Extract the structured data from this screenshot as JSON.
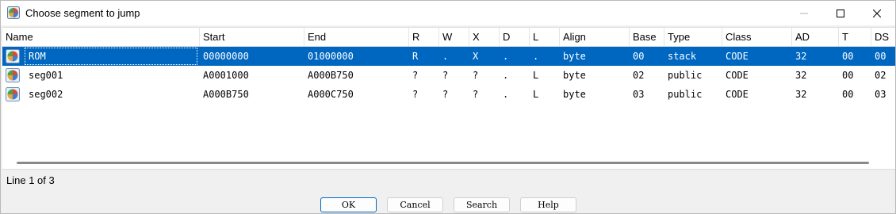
{
  "window": {
    "title": "Choose segment to jump"
  },
  "table": {
    "columns": [
      "Name",
      "Start",
      "End",
      "R",
      "W",
      "X",
      "D",
      "L",
      "Align",
      "Base",
      "Type",
      "Class",
      "AD",
      "T",
      "DS"
    ],
    "rows": [
      [
        "ROM",
        "00000000",
        "01000000",
        "R",
        ".",
        "X",
        ".",
        ".",
        "byte",
        "00",
        "stack",
        "CODE",
        "32",
        "00",
        "00"
      ],
      [
        "seg001",
        "A0001000",
        "A000B750",
        "?",
        "?",
        "?",
        ".",
        "L",
        "byte",
        "02",
        "public",
        "CODE",
        "32",
        "00",
        "02"
      ],
      [
        "seg002",
        "A000B750",
        "A000C750",
        "?",
        "?",
        "?",
        ".",
        "L",
        "byte",
        "03",
        "public",
        "CODE",
        "32",
        "00",
        "03"
      ]
    ],
    "selected_row": 0
  },
  "status": {
    "text": "Line 1 of 3"
  },
  "buttons": {
    "ok": "OK",
    "cancel": "Cancel",
    "search": "Search",
    "help": "Help"
  },
  "colors": {
    "selection": "#0067c0"
  },
  "icons": {
    "app": "ida-app-icon",
    "segment": "segment-icon"
  }
}
